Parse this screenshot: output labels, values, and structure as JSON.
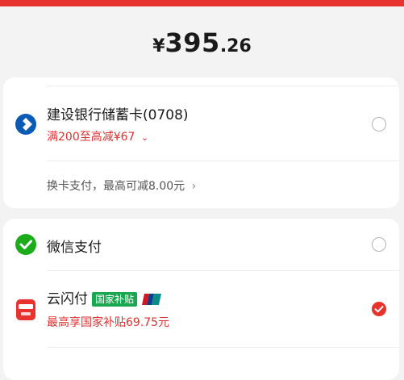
{
  "payment": {
    "currency_symbol": "¥",
    "amount_int": "395",
    "amount_dec": ".26"
  },
  "methods": {
    "ccb": {
      "title": "建设银行储蓄卡(0708)",
      "promo": "满200至高减¥67",
      "switch_card": "换卡支付，最高可减8.00元",
      "selected": false
    },
    "wechat": {
      "title": "微信支付",
      "selected": false
    },
    "unionpay": {
      "title": "云闪付",
      "badge": "国家补贴",
      "promo": "最高享国家补贴69.75元",
      "selected": true
    }
  },
  "colors": {
    "brand_red": "#e8322e",
    "promo_red": "#e03030",
    "wechat_green": "#1aad19",
    "ccb_blue": "#0a5bb5",
    "badge_green": "#19a84f"
  }
}
